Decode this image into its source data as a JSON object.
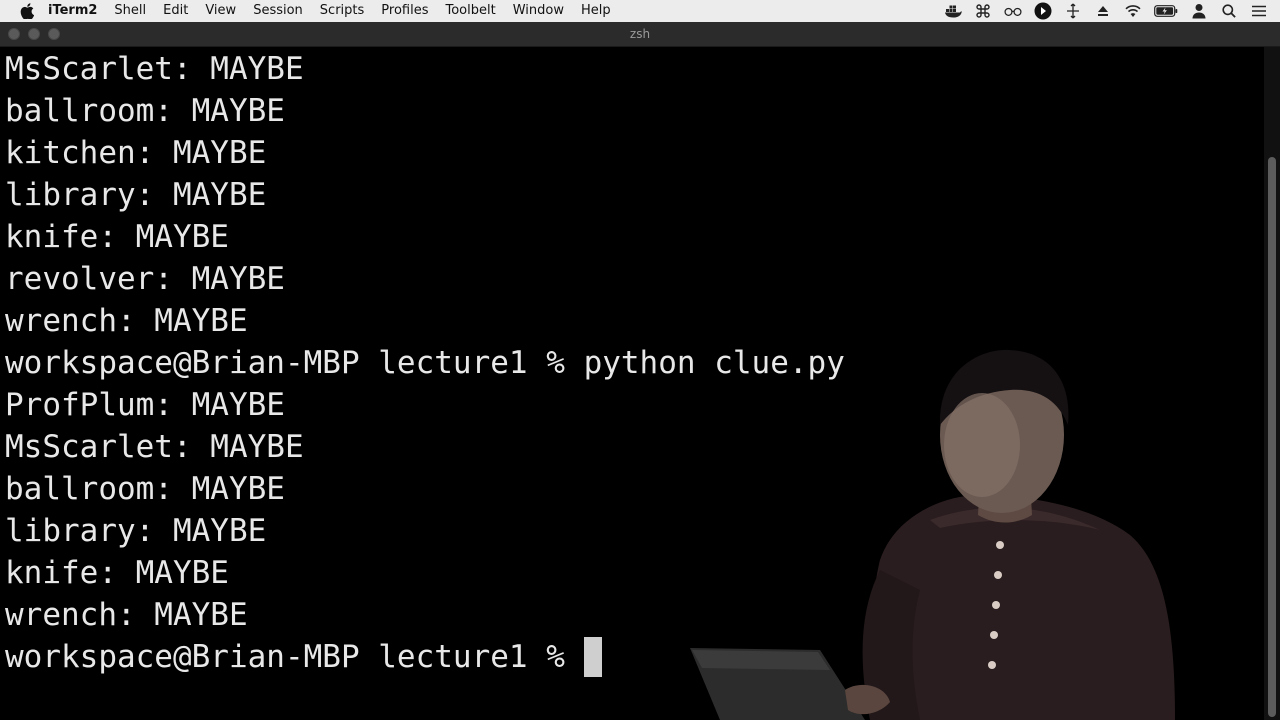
{
  "menubar": {
    "app_name": "iTerm2",
    "items": [
      "Shell",
      "Edit",
      "View",
      "Session",
      "Scripts",
      "Profiles",
      "Toolbelt",
      "Window",
      "Help"
    ],
    "status_icons": [
      "docker-icon",
      "command-icon",
      "glasses-icon",
      "play-icon",
      "move-icon",
      "eject-icon",
      "wifi-icon",
      "battery-icon",
      "user-icon",
      "search-icon",
      "control-center-icon"
    ]
  },
  "window": {
    "title": "zsh"
  },
  "terminal": {
    "lines": [
      "MsScarlet: MAYBE",
      "ballroom: MAYBE",
      "kitchen: MAYBE",
      "library: MAYBE",
      "knife: MAYBE",
      "revolver: MAYBE",
      "wrench: MAYBE",
      "workspace@Brian-MBP lecture1 % python clue.py",
      "ProfPlum: MAYBE",
      "MsScarlet: MAYBE",
      "ballroom: MAYBE",
      "library: MAYBE",
      "knife: MAYBE",
      "wrench: MAYBE"
    ],
    "prompt": "workspace@Brian-MBP lecture1 % "
  },
  "colors": {
    "background": "#000000",
    "foreground": "#e8e8e8",
    "menubar": "#ececec",
    "titlebar": "#2b2b2b"
  }
}
